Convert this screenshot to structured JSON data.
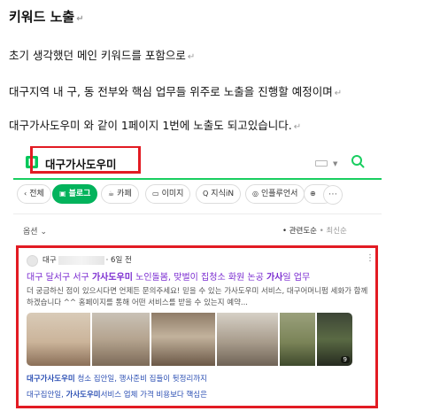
{
  "document": {
    "title": "키워드 노출",
    "paragraph_mark": "↵",
    "lines": [
      "초기 생각했던 메인 키워드를 포함으로",
      "대구지역 내 구, 동 전부와 핵심 업무들 위주로 노출을 진행할 예정이며",
      "대구가사도우미 와 같이 1페이지 1번에 노출도 되고있습니다."
    ]
  },
  "search": {
    "query": "대구가사도우미",
    "accent_color": "#19ce60",
    "highlight_color": "#e21b23"
  },
  "tabs": [
    {
      "label": "전체",
      "icon": "chevron-left-icon",
      "active": false
    },
    {
      "label": "블로그",
      "icon": "blog-icon",
      "active": true
    },
    {
      "label": "카페",
      "icon": "cafe-icon",
      "active": false
    },
    {
      "label": "이미지",
      "icon": "image-icon",
      "active": false
    },
    {
      "label": "지식iN",
      "icon": "kin-icon",
      "active": false
    },
    {
      "label": "인플루언서",
      "icon": "influencer-icon",
      "active": false
    },
    {
      "label": "...",
      "icon": "plus-icon",
      "active": false
    }
  ],
  "filters": {
    "options_label": "옵션",
    "sort_active": "• 관련도순",
    "sort_inactive": "• 최신순"
  },
  "result": {
    "author_prefix": "대구",
    "time": "6일 전",
    "title_parts": [
      "대구 달서구 서구 ",
      "가사도우미",
      " 노인돌봄, 맞벌이 집청소 화원 논공 ",
      "가사",
      "일 업무"
    ],
    "description": "더 궁금하신 점이 있으시다면 언제든 문의주세요! 믿을 수 있는 가사도우미 서비스, 대구어머니펌 세화가 함께하겠습니다 ^^ 홈페이지를 통해 어떤 서비스를 받을 수 있는지 예약...",
    "photo_count": "9",
    "sub_links": [
      {
        "bold": "대구가사도우미",
        "rest": " 청소 집안일, 행사준비 집들이 뒷정리까지"
      },
      {
        "bold": "가사도우미",
        "prefix": "대구집안일, ",
        "rest": "서비스 업체 가격 비용보다 핵심은"
      }
    ]
  }
}
